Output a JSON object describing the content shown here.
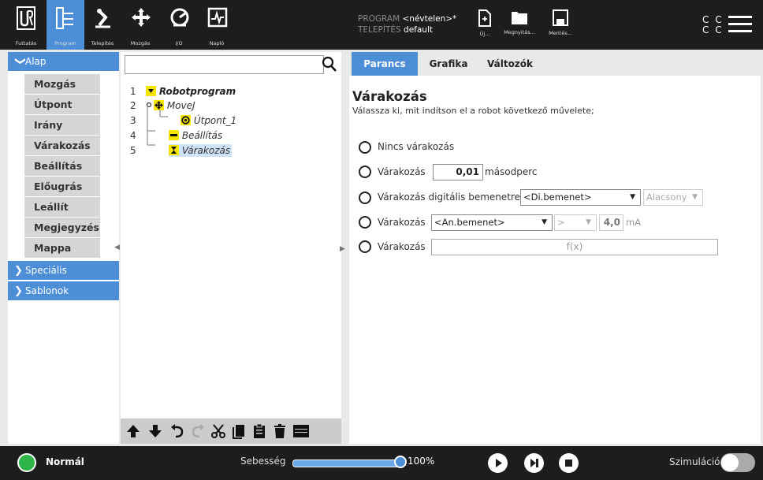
{
  "nav": {
    "run": "Futtatás",
    "program": "Program",
    "installation": "Telepítés",
    "move": "Mozgás",
    "io": "I/O",
    "log": "Napló"
  },
  "header": {
    "program_key": "PROGRAM",
    "program_val": "<névtelen>*",
    "install_key": "TELEPÍTÉS",
    "install_val": "default",
    "new_label": "Új...",
    "open_label": "Megnyitás...",
    "save_label": "Mentés...",
    "cc_row1": "C C",
    "cc_row2": "C C"
  },
  "sidebar": {
    "basic": "Alap",
    "items": [
      "Mozgás",
      "Útpont",
      "Irány",
      "Várakozás",
      "Beállítás",
      "Előugrás",
      "Leállít",
      "Megjegyzés",
      "Mappa"
    ],
    "advanced": "Speciális",
    "templates": "Sablonok"
  },
  "tree": {
    "search_placeholder": "",
    "rows": [
      {
        "num": "1",
        "label": "Robotprogram"
      },
      {
        "num": "2",
        "label": "MoveJ"
      },
      {
        "num": "3",
        "label": "Útpont_1"
      },
      {
        "num": "4",
        "label": "Beállítás"
      },
      {
        "num": "5",
        "label": "Várakozás"
      }
    ]
  },
  "tabs": {
    "command": "Parancs",
    "graphics": "Grafika",
    "variables": "Változók"
  },
  "command": {
    "title": "Várakozás",
    "description": "Válassza ki, mit indítson el a robot következő művelete;",
    "opt_none": "Nincs várakozás",
    "opt_wait": "Várakozás",
    "wait_value": "0,01",
    "wait_unit": "másodperc",
    "opt_digital": "Várakozás digitális bemenetre",
    "digital_input": "<Di.bemenet>",
    "digital_state": "Alacsony",
    "opt_analog": "Várakozás",
    "analog_input": "<An.bemenet>",
    "analog_op": ">",
    "analog_value": "4,0",
    "analog_unit": "mA",
    "opt_expr": "Várakozás",
    "expr_placeholder": "f(x)"
  },
  "footer": {
    "status": "Normál",
    "speed_label": "Sebesség",
    "speed_value": "100%",
    "speed_fraction": 1.0,
    "simulation": "Szimuláció"
  },
  "colors": {
    "accent": "#4d8fd6",
    "topbar": "#1d1d1d",
    "status_ok": "#2db54a",
    "node_yellow": "#f5e400"
  }
}
